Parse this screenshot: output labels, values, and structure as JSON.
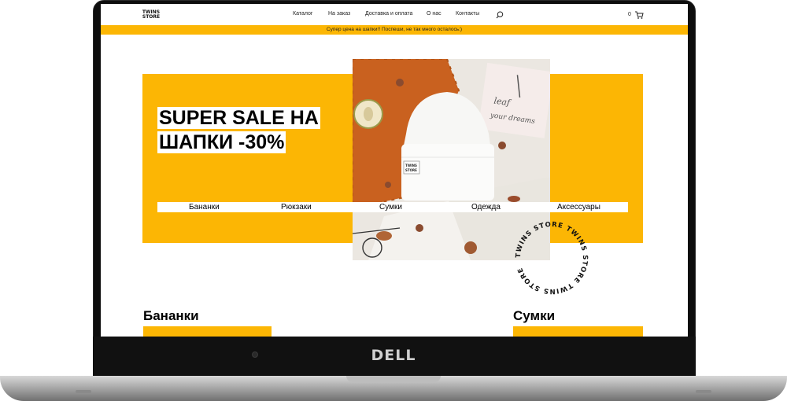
{
  "device": {
    "brand": "DELL"
  },
  "site": {
    "logo": "TWINS STORE",
    "nav": {
      "catalog": "Каталог",
      "order": "На заказ",
      "delivery": "Доставка и оплата",
      "about": "О нас",
      "contacts": "Контакты"
    },
    "cart_count": "0",
    "promo": "Супер цена на шапки!! Поспеши, не так много осталось:)"
  },
  "hero": {
    "title_line1": "SUPER SALE НА",
    "title_line2": "ШАПКИ -30%",
    "categories": [
      "Бананки",
      "Рюкзаки",
      "Сумки",
      "Одежда",
      "Аксессуары"
    ]
  },
  "badge_text": "TWINS STORE TWINS STORE TWINS STORE",
  "sections": {
    "left_title": "Бананки",
    "right_title": "Сумки"
  },
  "colors": {
    "accent": "#fcb604",
    "laptop_bezel": "#0d0d0d"
  },
  "icons": [
    "search-icon",
    "cart-icon"
  ]
}
